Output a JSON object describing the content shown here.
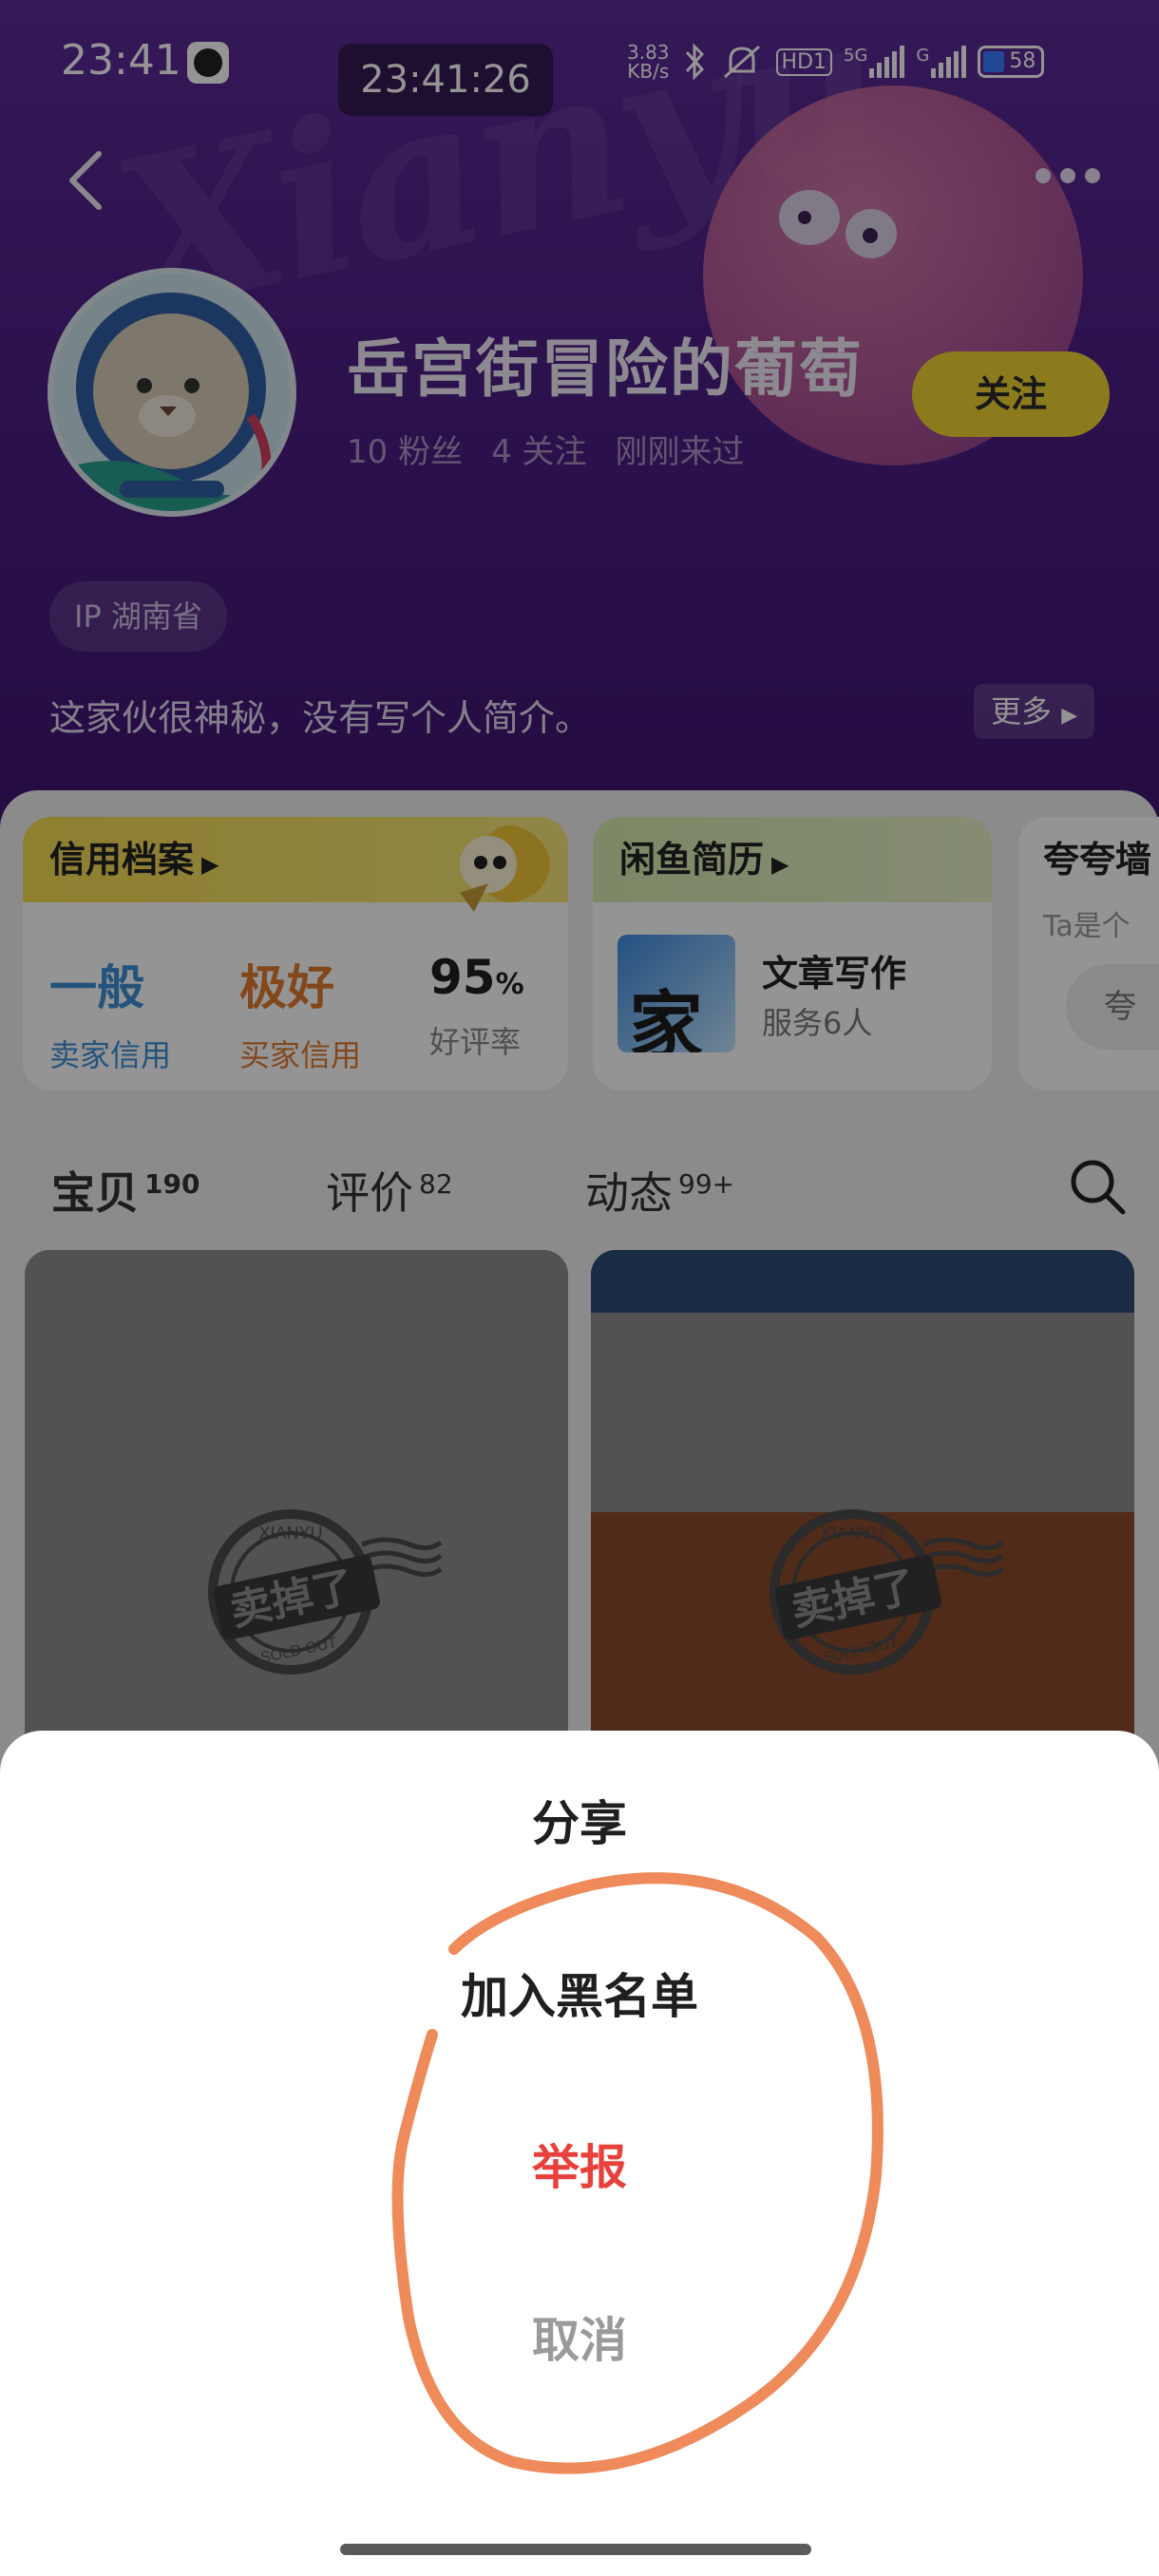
{
  "status_bar": {
    "time": "23:41",
    "pill_time": "23:41:26",
    "net_speed_value": "3.83",
    "net_speed_unit": "KB/s",
    "hd_label": "HD1",
    "sig1_label": "5G",
    "sig2_label": "G",
    "battery": "58"
  },
  "profile": {
    "username": "岳宫街冒险的葡萄",
    "fans": "10 粉丝",
    "following": "4 关注",
    "last_seen": "刚刚来过",
    "follow_label": "关注",
    "ip_tag": "IP 湖南省",
    "bio": "这家伙很神秘，没有写个人简介。",
    "bio_more": "更多"
  },
  "credit_card": {
    "title": "信用档案",
    "seller_credit_value": "一般",
    "seller_credit_label": "卖家信用",
    "buyer_credit_value": "极好",
    "buyer_credit_label": "买家信用",
    "positive_rate_value": "95",
    "positive_rate_unit": "%",
    "positive_rate_label": "好评率"
  },
  "resume_card": {
    "title": "闲鱼简历",
    "thumb_char": "家",
    "service_title": "文章写作",
    "service_sub": "服务6人"
  },
  "praise_card": {
    "title": "夸夸墙",
    "sub": "Ta是个",
    "button": "夸"
  },
  "tabs": [
    {
      "label": "宝贝",
      "count": "190"
    },
    {
      "label": "评价",
      "count": "82"
    },
    {
      "label": "动态",
      "count": "99+"
    }
  ],
  "items": [
    {
      "stamp_top": "XIANYU",
      "stamp_main": "卖掉了",
      "stamp_bottom": "SOLD OUT"
    },
    {
      "stamp_top": "XIANYU",
      "stamp_main": "卖掉了",
      "stamp_bottom": "SOLD OUT"
    }
  ],
  "sheet": {
    "share": "分享",
    "block": "加入黑名单",
    "report": "举报",
    "cancel": "取消"
  },
  "colors": {
    "header_purple": "#4d1f86",
    "accent_yellow": "#f1d532",
    "seller_blue": "#3d8fd6",
    "buyer_orange": "#e07a2e",
    "report_red": "#e8413c",
    "annotation_orange": "#ef8a5a"
  }
}
